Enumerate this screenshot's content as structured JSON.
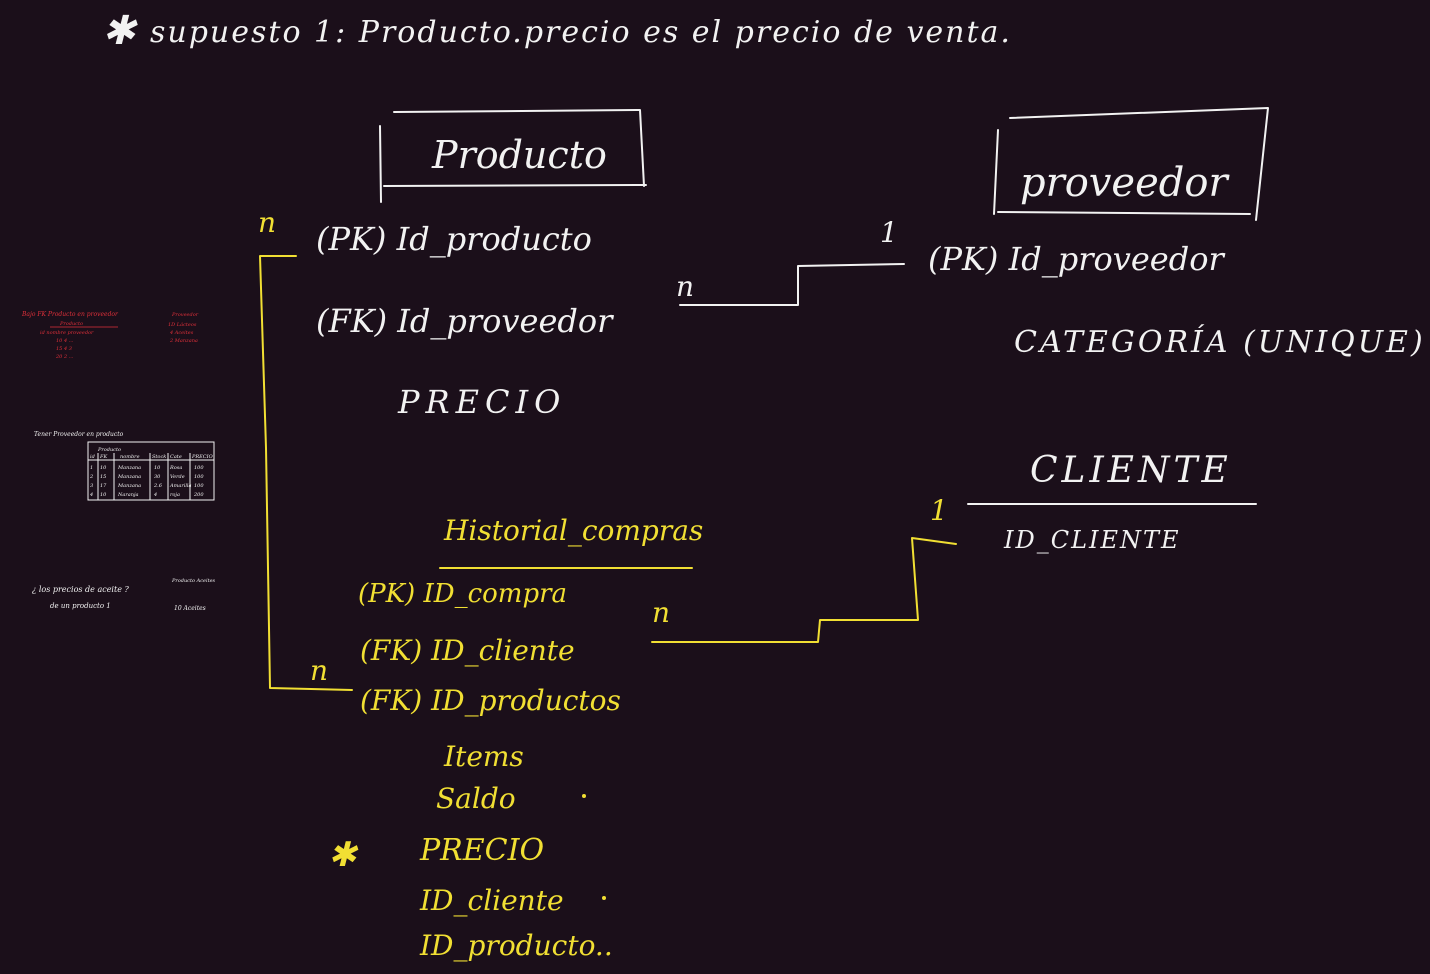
{
  "header": {
    "star": "✱",
    "note": "supuesto 1:  Producto.precio es el precio de venta."
  },
  "colors": {
    "background": "#1b0f1a",
    "ink_white": "#f2f2f2",
    "ink_yellow": "#f1df33",
    "ink_red": "#e0303a"
  },
  "producto": {
    "title": "Producto",
    "fields": [
      "(PK) Id_producto",
      "(FK) Id_proveedor",
      "PRECIO"
    ]
  },
  "proveedor": {
    "title": "proveedor",
    "fields": [
      "(PK) Id_proveedor",
      "CATEGORÍA (UNIQUE)"
    ]
  },
  "cliente": {
    "title": "CLIENTE",
    "fields": [
      "ID_CLIENTE"
    ]
  },
  "historial": {
    "title": "Historial_compras",
    "fields": [
      "(PK) ID_compra",
      "(FK) ID_cliente",
      "(FK) ID_productos",
      "Items",
      "Saldo",
      "PRECIO",
      "ID_cliente",
      "ID_producto.."
    ],
    "star": "✱"
  },
  "cardinality": {
    "prod_prov_many": "n",
    "prod_prov_one": "1",
    "prod_hist_top": "n",
    "prod_hist_bottom": "n",
    "hist_cli_many": "n",
    "hist_cli_one": "1"
  },
  "thumbnails": {
    "red_title": "Bajo FK Producto en proveedor",
    "red_sub": "Producto",
    "red_rows": [
      "id  nombre  proveedor",
      "10  4  ...",
      "15  4  3",
      "20  2  ..."
    ],
    "red_right_title": "Proveedor",
    "red_right_rows": [
      "1D  Lácteos",
      "4  Aceites",
      "2  Manzana"
    ],
    "table_title": "Tener Proveedor en producto",
    "table_sub": "Producto",
    "table_headers": [
      "id",
      "FK",
      "nombre",
      "Stock",
      "Cate",
      "PRECIO"
    ],
    "table_rows": [
      [
        "1",
        "10",
        "Manzana",
        "10",
        "Rosa",
        "100"
      ],
      [
        "2",
        "15",
        "Manzana",
        "30",
        "Verde",
        "100"
      ],
      [
        "3",
        "17",
        "Manzana",
        "2.6",
        "Amarilla",
        "100"
      ],
      [
        "4",
        "10",
        "Naranja",
        "4",
        "roja",
        "200"
      ]
    ],
    "question_line1": "¿ los precios de aceite ?",
    "question_line2": "de un producto 1",
    "q_right_1": "Producto Aceites",
    "q_right_2": "10 Aceites"
  }
}
